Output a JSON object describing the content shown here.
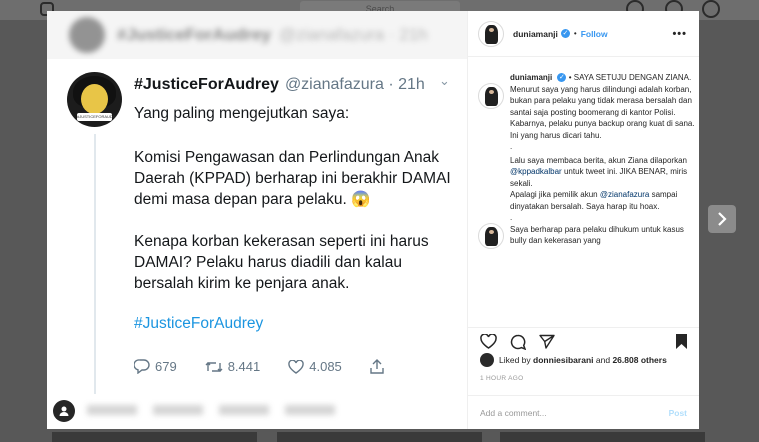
{
  "background": {
    "search_placeholder": "Search"
  },
  "tweet": {
    "blurred_header_name": "#JusticeForAudrey",
    "blurred_header_handle": "@zianafazura · 21h",
    "avatar_tag": "#JUSTICEFORAUDREY",
    "name": "#JusticeForAudrey",
    "handle_time": "@zianafazura · 21h",
    "line1": "Yang paling mengejutkan saya:",
    "para1": "Komisi Pengawasan dan Perlindungan Anak Daerah (KPPAD) berharap ini berakhir DAMAI demi masa depan para pelaku. 😱",
    "para2": "Kenapa korban kekerasan seperti ini harus DAMAI? Pelaku harus diadili dan kalau bersalah kirim ke penjara anak.",
    "hashtag": "#JusticeForAudrey",
    "replies": "679",
    "retweets": "8.441",
    "likes": "4.085"
  },
  "panel": {
    "username": "duniamanji",
    "follow_label": "Follow",
    "caption_user": "duniamanji",
    "caption_text_1": "• SAYA SETUJU DENGAN ZIANA. Menurut saya yang harus dilindungi adalah korban, bukan para pelaku yang tidak merasa bersalah dan santai saja posting boomerang di kantor Polisi.",
    "caption_text_2": "Kabarnya, pelaku punya backup orang kuat di sana. Ini yang harus dicari tahu.",
    "caption_dot_1": ".",
    "caption_text_3a": "Lalu saya membaca berita, akun Ziana dilaporkan",
    "caption_mention_1": "@kppadkalbar",
    "caption_text_3b": "untuk tweet ini. JIKA BENAR, miris sekali.",
    "caption_text_4a": "Apalagi jika pemilik akun",
    "caption_mention_2": "@zianafazura",
    "caption_text_4b": "sampai dinyatakan bersalah. Saya harap itu hoax.",
    "caption_dot_2": ".",
    "caption_text_5": "Saya berharap para pelaku dihukum untuk kasus bully dan kekerasan yang",
    "liked_by_prefix": "Liked by",
    "liked_by_user": "donniesibarani",
    "liked_by_and": "and",
    "liked_by_count": "26.808 others",
    "time_ago": "1 HOUR AGO",
    "comment_placeholder": "Add a comment...",
    "post_label": "Post"
  },
  "colors": {
    "link_blue": "#3897f0",
    "twitter_blue": "#1b95e0",
    "overlay": "#585858"
  }
}
